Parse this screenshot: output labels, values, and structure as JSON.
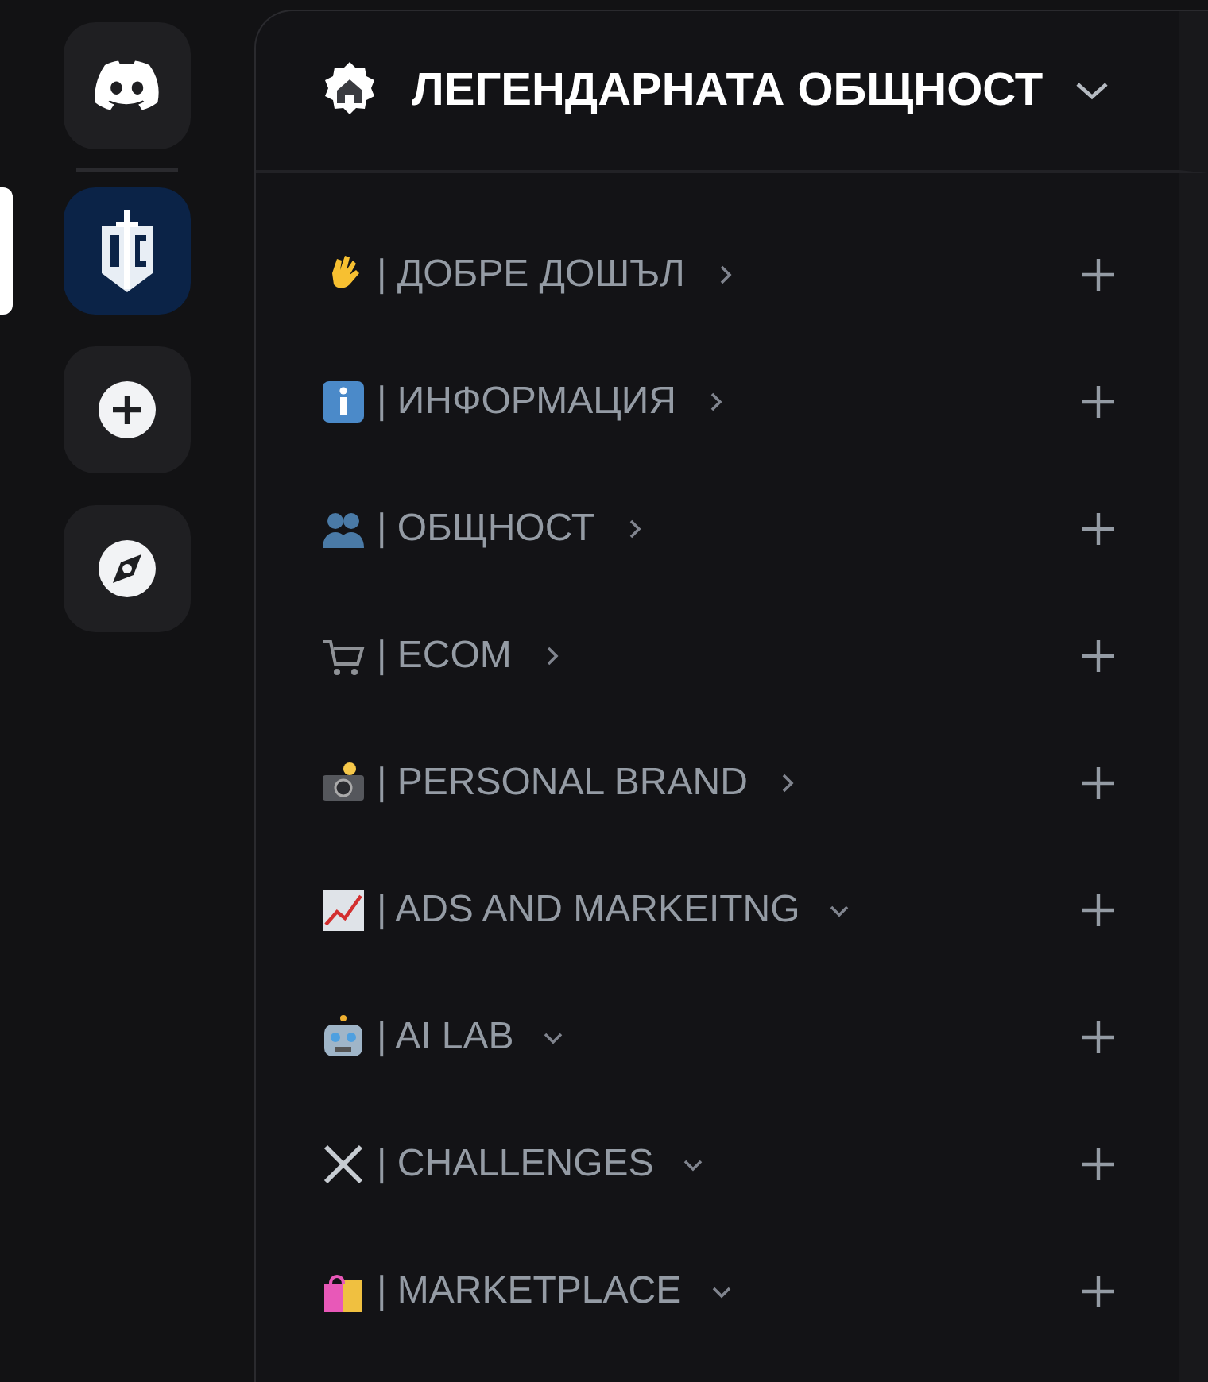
{
  "server": {
    "name": "ЛЕГЕНДАРНАТА ОБЩНОСТ"
  },
  "categories": [
    {
      "kind": "hand",
      "label": "| ДОБРЕ ДОШЪЛ",
      "expanded": false
    },
    {
      "kind": "info",
      "label": "| ИНФОРМАЦИЯ",
      "expanded": false
    },
    {
      "kind": "people",
      "label": "| ОБЩНОСТ",
      "expanded": false
    },
    {
      "kind": "cart",
      "label": "| ECOM",
      "expanded": false
    },
    {
      "kind": "camera",
      "label": "| PERSONAL BRAND",
      "expanded": false
    },
    {
      "kind": "chart",
      "label": "| ADS AND MARKEITNG",
      "expanded": true
    },
    {
      "kind": "robot",
      "label": "| AI LAB",
      "expanded": true
    },
    {
      "kind": "swords",
      "label": "| CHALLENGES",
      "expanded": true
    },
    {
      "kind": "bags",
      "label": "| MARKETPLACE",
      "expanded": true
    }
  ]
}
